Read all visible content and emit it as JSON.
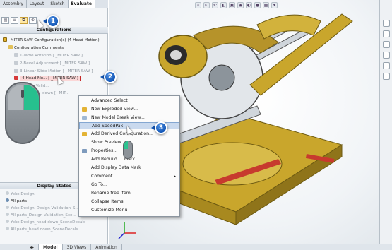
{
  "tabs": [
    "Assembly",
    "Layout",
    "Sketch",
    "Evaluate"
  ],
  "configurations": {
    "title": "Configurations",
    "root": "_MITER SAW Configuration(s)  (4-Head Motion)",
    "comments": "Configuration Comments",
    "items": [
      "1-Table Rotation [ _MITER SAW ]",
      "2-Bevel Adjustment [ _MITER SAW ]",
      "3-Linear Slide Motion [ _MITER SAW ]",
      "4-Head Mo... [ _MITER SAW ]"
    ],
    "partial_rows": [
      "esign Valid...",
      "down [ _MIT..."
    ]
  },
  "display_states": {
    "title": "Display States",
    "items": [
      "Yoke Design",
      "All parts",
      "Yoke Design_Design Validation_S...",
      "All parts_Design Validation_Sce...",
      "Yoke Design_head down_SceneDecals",
      "All parts_head down_SceneDecals"
    ],
    "active_index": 1
  },
  "context_menu": {
    "items": [
      "Advanced Select",
      "New Exploded View...",
      "New Model Break View...",
      "Add SpeedPak",
      "Add Derived Configuration...",
      "Show Preview",
      "Properties...",
      "Add Rebuild ... Mark",
      "Add Display Data Mark",
      "Comment",
      "Go To...",
      "Rename tree item",
      "Collapse Items",
      "Customize Menu"
    ],
    "selected_index": 3,
    "submenu_index": 9
  },
  "callouts": [
    "1",
    "2",
    "3"
  ],
  "bottom_tabs": [
    "Model",
    "3D Views",
    "Animation"
  ],
  "colors": {
    "accent_blue": "#1458b8",
    "selection": "#c9d9ee",
    "highlight_red": "#c62828",
    "mouse_green": "#27c08e",
    "model_yellow": "#c9a62c"
  }
}
